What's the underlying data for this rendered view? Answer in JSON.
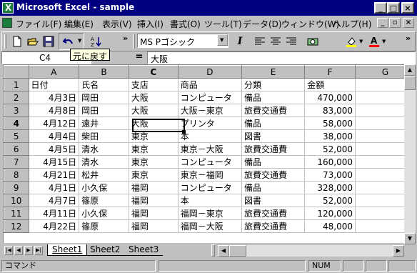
{
  "window": {
    "title": "Microsoft Excel - sample",
    "caption_buttons": [
      "_",
      "□",
      "×"
    ]
  },
  "menubar": {
    "items": [
      "ファイル(F)",
      "編集(E)",
      "表示(V)",
      "挿入(I)",
      "書式(O)",
      "ツール(T)",
      "データ(D)",
      "ウィンドウ(W)",
      "ヘルプ(H)"
    ]
  },
  "toolbar": {
    "font_name": "MS Pゴシック",
    "italic_label": "I",
    "tooltip": "元に戻す"
  },
  "formula_bar": {
    "name_box": "C4",
    "equals": "=",
    "formula": "大阪"
  },
  "sheet": {
    "columns": [
      "",
      "A",
      "B",
      "C",
      "D",
      "E",
      "F",
      "G"
    ],
    "active_cell": "C4",
    "rows": [
      {
        "n": "1",
        "a": "日付",
        "b": "氏名",
        "c": "支店",
        "d": "商品",
        "e": "分類",
        "f": "金額"
      },
      {
        "n": "2",
        "a": "4月3日",
        "b": "岡田",
        "c": "大阪",
        "d": "コンピュータ",
        "e": "備品",
        "f": "470,000"
      },
      {
        "n": "3",
        "a": "4月8日",
        "b": "岡田",
        "c": "大阪",
        "d": "大阪－東京",
        "e": "旅費交通費",
        "f": "83,000"
      },
      {
        "n": "4",
        "a": "4月12日",
        "b": "遠井",
        "c": "大阪",
        "d": "プリンタ",
        "e": "備品",
        "f": "58,000"
      },
      {
        "n": "5",
        "a": "4月4日",
        "b": "柴田",
        "c": "東京",
        "d": "本",
        "e": "図書",
        "f": "38,000"
      },
      {
        "n": "6",
        "a": "4月5日",
        "b": "清水",
        "c": "東京",
        "d": "東京－大阪",
        "e": "旅費交通費",
        "f": "52,000"
      },
      {
        "n": "7",
        "a": "4月15日",
        "b": "清水",
        "c": "東京",
        "d": "コンピュータ",
        "e": "備品",
        "f": "160,000"
      },
      {
        "n": "8",
        "a": "4月21日",
        "b": "松井",
        "c": "東京",
        "d": "東京－福岡",
        "e": "旅費交通費",
        "f": "73,000"
      },
      {
        "n": "9",
        "a": "4月1日",
        "b": "小久保",
        "c": "福岡",
        "d": "コンピュータ",
        "e": "備品",
        "f": "328,000"
      },
      {
        "n": "10",
        "a": "4月7日",
        "b": "篠原",
        "c": "福岡",
        "d": "本",
        "e": "図書",
        "f": "52,000"
      },
      {
        "n": "11",
        "a": "4月11日",
        "b": "小久保",
        "c": "福岡",
        "d": "福岡－東京",
        "e": "旅費交通費",
        "f": "120,000"
      },
      {
        "n": "12",
        "a": "4月22日",
        "b": "篠原",
        "c": "福岡",
        "d": "福岡－大阪",
        "e": "旅費交通費",
        "f": "48,000"
      }
    ]
  },
  "tabs": {
    "nav": [
      "|◀",
      "◀",
      "▶",
      "▶|"
    ],
    "sheets": [
      "Sheet1",
      "Sheet2",
      "Sheet3"
    ],
    "active": "Sheet1"
  },
  "statusbar": {
    "mode": "コマンド",
    "num": "NUM"
  },
  "colors": {
    "title_bar": "#000080",
    "face": "#c0c0c0",
    "tooltip": "#ffffe1"
  }
}
